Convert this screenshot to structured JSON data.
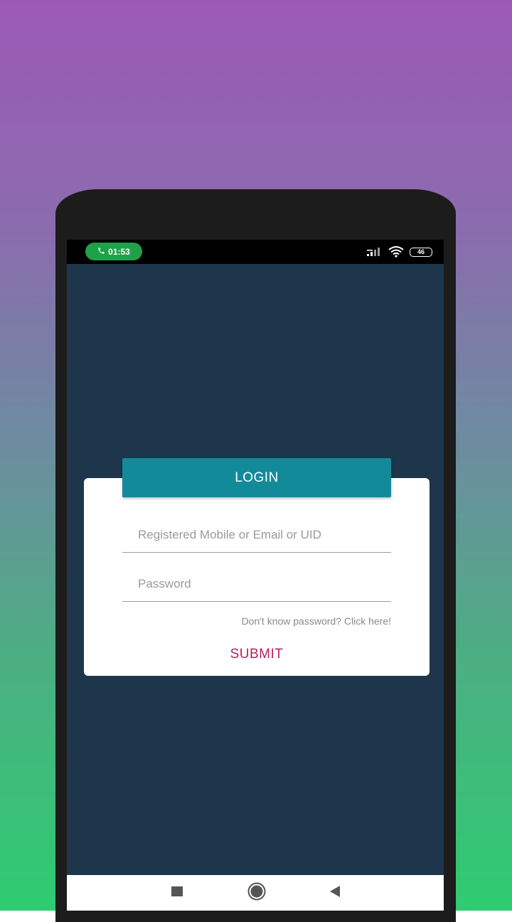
{
  "status_bar": {
    "call_time": "01:53",
    "battery_level": "46"
  },
  "login": {
    "header_label": "LOGIN",
    "username_placeholder": "Registered Mobile or Email or UID",
    "password_placeholder": "Password",
    "forgot_text": "Don't know password? Click here!",
    "submit_label": "SUBMIT"
  },
  "colors": {
    "screen_bg": "#1d364b",
    "header_bg": "#138a9a",
    "submit_text": "#b5225e",
    "call_pill": "#1fa14a"
  },
  "icons": {
    "call": "phone-icon",
    "signal": "signal-icon",
    "wifi": "wifi-icon",
    "battery": "battery-icon",
    "nav_recent": "square-icon",
    "nav_home": "circle-icon",
    "nav_back": "triangle-back-icon"
  }
}
